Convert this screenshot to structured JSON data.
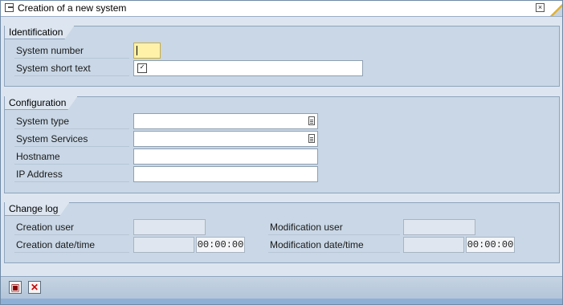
{
  "window": {
    "title": "Creation of a new system",
    "close_glyph": "×"
  },
  "identification": {
    "title": "Identification",
    "system_number_label": "System number",
    "system_number_value": "",
    "system_short_text_label": "System short text",
    "system_short_text_value": "",
    "checkbox_glyph": "✓"
  },
  "configuration": {
    "title": "Configuration",
    "system_type_label": "System type",
    "system_type_value": "",
    "system_services_label": "System Services",
    "system_services_value": "",
    "hostname_label": "Hostname",
    "hostname_value": "",
    "ip_address_label": "IP Address",
    "ip_address_value": ""
  },
  "change_log": {
    "title": "Change log",
    "creation_user_label": "Creation user",
    "creation_user_value": "",
    "creation_datetime_label": "Creation date/time",
    "creation_date_value": "",
    "creation_time_value": "00:00:00",
    "modification_user_label": "Modification user",
    "modification_user_value": "",
    "modification_datetime_label": "Modification date/time",
    "modification_date_value": "",
    "modification_time_value": "00:00:00"
  },
  "footer": {
    "save_glyph": "▣",
    "cancel_glyph": "✕"
  },
  "icons": {
    "window": "window-icon",
    "close": "close-icon",
    "value_help": "value-help-icon",
    "save": "save-icon",
    "cancel": "cancel-icon"
  },
  "colors": {
    "required_field": "#fff1a8",
    "background": "#c9d7e6"
  }
}
